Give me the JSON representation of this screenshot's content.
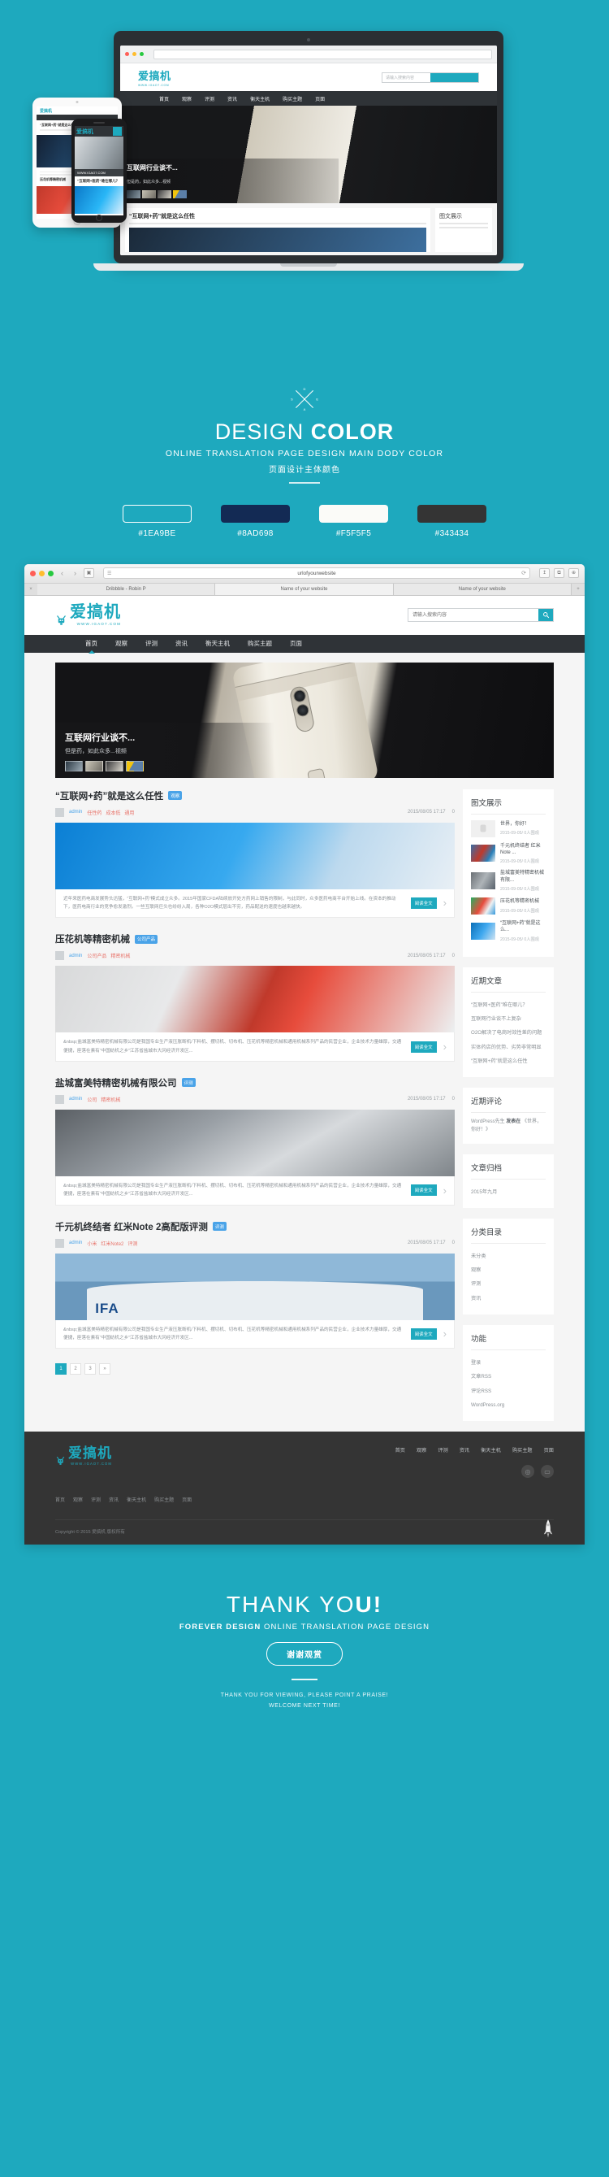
{
  "brand": {
    "name": "爱搞机",
    "domain": "WWW.IGAO7.COM",
    "accent": "#1ea9be"
  },
  "design_color": {
    "title_light": "DESIGN",
    "title_bold": "COLOR",
    "subtitle": "ONLINE TRANSLATION PAGE DESIGN MAIN DODY COLOR",
    "subtitle_cn": "页面设计主体颜色",
    "swatches": [
      {
        "hex": "#1EA9BE",
        "label": "#1EA9BE",
        "outline": true
      },
      {
        "hex": "#8AD698",
        "label": "#8AD698",
        "outline": false
      },
      {
        "hex": "#F5F5F5",
        "label": "#F5F5F5",
        "outline": false
      },
      {
        "hex": "#343434",
        "label": "#343434",
        "outline": false
      }
    ]
  },
  "browser": {
    "url": "urlofyourwebsite",
    "tabs": [
      {
        "label": "Dribbble - Robin P"
      },
      {
        "label": "Name of your website"
      },
      {
        "label": "Name of your website"
      }
    ],
    "dots": [
      "#ff5f57",
      "#ffbd2e",
      "#28c940"
    ],
    "back_icon": "‹",
    "forward_icon": "›",
    "sidebar_icon": "▣",
    "reader_icon": "☰",
    "reload_icon": "⟳",
    "share_icon": "↥",
    "tabs_icon": "⧉",
    "menu_icon": "⊕",
    "close_tab_icon": "×",
    "add_tab_icon": "+"
  },
  "site": {
    "search_placeholder": "请输入搜索内容",
    "search_value": "",
    "nav": [
      {
        "label": "首页",
        "active": true
      },
      {
        "label": "观察",
        "active": false
      },
      {
        "label": "评测",
        "active": false
      },
      {
        "label": "资讯",
        "active": false
      },
      {
        "label": "衡天主机",
        "active": false
      },
      {
        "label": "购买主题",
        "active": false
      },
      {
        "label": "页面",
        "active": false
      }
    ],
    "hero": {
      "title": "互联网行业谈不...",
      "subtitle": "但是药，如此众多...视频"
    },
    "posts": [
      {
        "title": "“互联网+药”就是这么任性",
        "category": "观察",
        "author": "admin",
        "tags": [
          "任性药",
          "成本低",
          "通用"
        ],
        "date": "2015/08/05 17:17",
        "comments": "0",
        "excerpt": "近年来医药电商发展势头迅猛，“互联网+药”模式成立众多。2015年国家CFDA陆续放开处方药网上销售的限制，与此同时，众多医药电商平台开始上线。在资本的推动下，医药电商行业的竞争愈发激烈。一些互联网巨头也纷纷入局，各种O2O模式层出不穷，药品配送的速度也越来越快。",
        "read_label": "阅读全文",
        "img_class": "pi-1"
      },
      {
        "title": "压花机等精密机械",
        "category": "公司产品",
        "author": "admin",
        "tags": [
          "公司产品",
          "精密机械"
        ],
        "date": "2015/08/05 17:17",
        "comments": "0",
        "excerpt": "&nbsp;盐城富美特精密机械有限公司是我国专业生产液压胀断机/下料机、摆切机、切布机、压花机等精密机械和通用机械系列产品的民营企业，企业技术力量雄厚，交通便捷，座落在素有“中国纺机之乡”江苏省盐城市大冈经济开发区...",
        "read_label": "阅读全文",
        "img_class": "pi-2"
      },
      {
        "title": "盐城富美特精密机械有限公司",
        "category": "评测",
        "author": "admin",
        "tags": [
          "公司",
          "精密机械"
        ],
        "date": "2015/08/05 17:17",
        "comments": "0",
        "excerpt": "&nbsp;盐城富美特精密机械有限公司是我国专业生产液压胀断机/下料机、摆切机、切布机、压花机等精密机械和通用机械系列产品的民营企业，企业技术力量雄厚，交通便捷，座落在素有“中国纺机之乡”江苏省盐城市大冈经济开发区...",
        "read_label": "阅读全文",
        "img_class": "pi-3"
      },
      {
        "title": "千元机终结者 红米Note 2高配版评测",
        "category": "评测",
        "author": "admin",
        "tags": [
          "小米",
          "红米Note2",
          "评测"
        ],
        "date": "2015/08/05 17:17",
        "comments": "0",
        "excerpt": "&nbsp;盐城富美特精密机械有限公司是我国专业生产液压胀断机/下料机、摆切机、切布机、压花机等精密机械和通用机械系列产品的民营企业，企业技术力量雄厚，交通便捷，座落在素有“中国纺机之乡”江苏省盐城市大冈经济开发区...",
        "read_label": "阅读全文",
        "img_class": "pi-4"
      }
    ],
    "pagination": [
      "1",
      "2",
      "3",
      "»"
    ],
    "widgets": {
      "gallery": {
        "title": "图文展示",
        "items": [
          {
            "title": "世界，你好！",
            "meta": "2015-09-05/ 0人围观",
            "thumb": "wt-0"
          },
          {
            "title": "千元机终结者 红米Note ...",
            "meta": "2015-09-05/ 0人围观",
            "thumb": "wt-1"
          },
          {
            "title": "盐城富美特精密机械有限...",
            "meta": "2015-09-05/ 0人围观",
            "thumb": "wt-2"
          },
          {
            "title": "压花机等精密机械",
            "meta": "2015-09-05/ 0人围观",
            "thumb": "wt-3"
          },
          {
            "title": "“互联网+药”就是这么...",
            "meta": "2015-09-05/ 0人围观",
            "thumb": "wt-4"
          }
        ]
      },
      "recent_posts": {
        "title": "近期文章",
        "items": [
          "“互联网+医药”难在哪儿？",
          "互联网行业谈不上复杂",
          "O2O解决了电商时效性差的问题",
          "实体药店的优势、劣势非常明显",
          "“互联网+药”就是这么任性"
        ]
      },
      "recent_comments": {
        "title": "近期评论",
        "text_plain": "WordPress先生",
        "text_bold": "发表在",
        "text_link": "《世界，你好！》"
      },
      "archives": {
        "title": "文章归档",
        "items": [
          "2015年九月"
        ]
      },
      "categories": {
        "title": "分类目录",
        "items": [
          "未分类",
          "观察",
          "评测",
          "资讯"
        ]
      },
      "meta": {
        "title": "功能",
        "items": [
          "登录",
          "文章RSS",
          "评论RSS",
          "WordPress.org"
        ]
      }
    },
    "footer": {
      "nav": [
        "首页",
        "观察",
        "评测",
        "资讯",
        "衡天主机",
        "购买主题",
        "页面"
      ],
      "social": [
        {
          "name": "weibo-icon",
          "glyph": "◎"
        },
        {
          "name": "wechat-icon",
          "glyph": "▭"
        }
      ],
      "links": [
        "首页",
        "观察",
        "评测",
        "资讯",
        "衡天主机",
        "购买主题",
        "页面"
      ],
      "copyright": "Copyright © 2015 爱搞机 版权所有"
    }
  },
  "thanks": {
    "title_light": "THANK YO",
    "title_bold": "U!",
    "subtitle_bold": "FOREVER DESIGN",
    "subtitle_light": "ONLINE TRANSLATION PAGE DESIGN",
    "button": "谢谢观赏",
    "line1": "THANK YOU FOR VIEWING, PLEASE POINT A PRAISE!",
    "line2": "WELCOME NEXT TIME!"
  }
}
